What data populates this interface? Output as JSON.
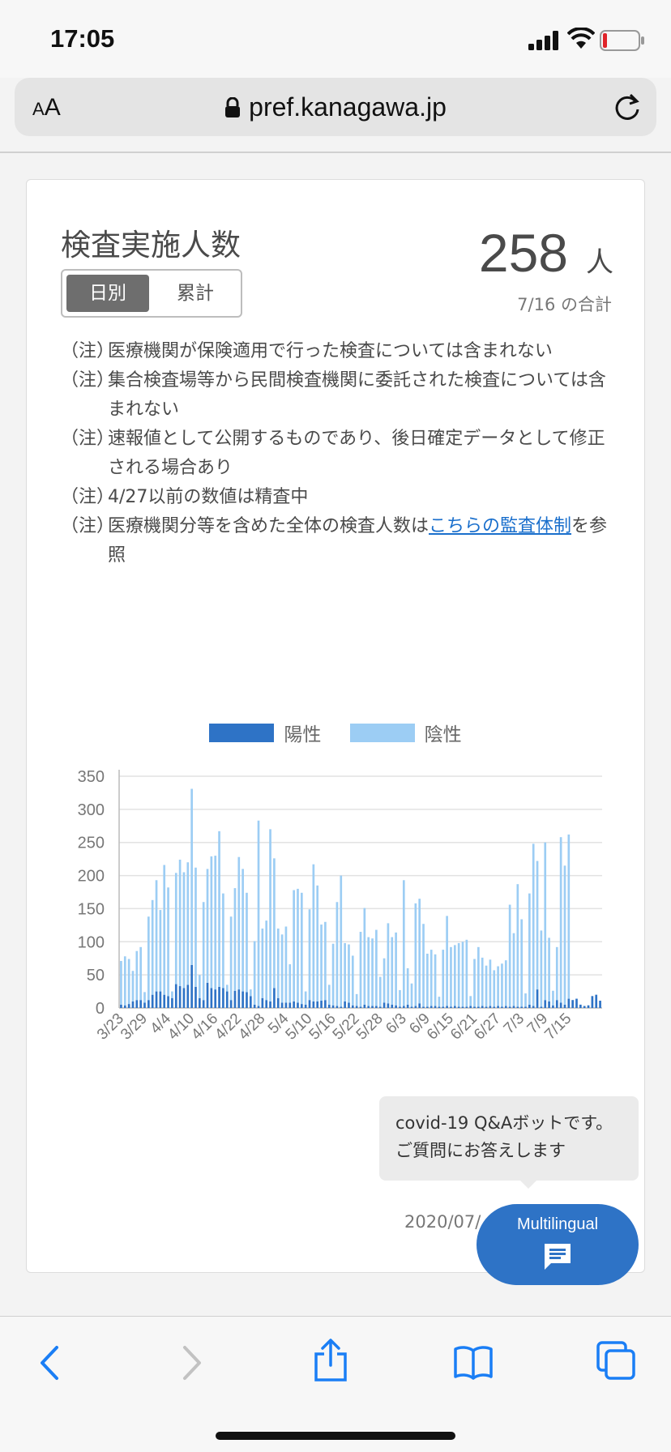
{
  "status_bar": {
    "time": "17:05"
  },
  "url_bar": {
    "text_size_label_small": "A",
    "text_size_label_large": "A",
    "domain": "pref.kanagawa.jp"
  },
  "card": {
    "title": "検査実施人数",
    "toggle": {
      "daily": "日別",
      "cumulative": "累計",
      "selected": "日別"
    },
    "total": {
      "value": "258",
      "unit": "人",
      "caption": "7/16 の合計"
    },
    "notes": [
      {
        "mark": "（注）",
        "text": "医療機関が保険適用で行った検査については含まれない"
      },
      {
        "mark": "（注）",
        "text": "集合検査場等から民間検査機関に委託された検査については含まれない"
      },
      {
        "mark": "（注）",
        "text": "速報値として公開するものであり、後日確定データとして修正される場合あり"
      },
      {
        "mark": "（注）",
        "text": "4/27以前の数値は精査中"
      },
      {
        "mark": "（注）",
        "text_before": "医療機関分等を含めた全体の検査人数は",
        "link": "こちらの監査体制",
        "text_after": "を参照"
      }
    ],
    "updated": "2020/07/"
  },
  "chart_data": {
    "type": "bar",
    "stacked": true,
    "x_tick_labels": [
      "3/23",
      "3/29",
      "4/4",
      "4/10",
      "4/16",
      "4/22",
      "4/28",
      "5/4",
      "5/10",
      "5/16",
      "5/22",
      "5/28",
      "6/3",
      "6/9",
      "6/15",
      "6/21",
      "6/27",
      "7/3",
      "7/9",
      "7/15"
    ],
    "first_day": "3/23",
    "last_day": "7/16",
    "ylim": [
      0,
      350
    ],
    "yticks": [
      0,
      50,
      100,
      150,
      200,
      250,
      300,
      350
    ],
    "grid": true,
    "legend_position": "top",
    "series": [
      {
        "name": "陽性",
        "color": "#2e73c6",
        "values": [
          5,
          4,
          6,
          10,
          12,
          12,
          8,
          12,
          20,
          25,
          25,
          20,
          18,
          15,
          36,
          33,
          30,
          35,
          65,
          32,
          15,
          12,
          38,
          30,
          28,
          32,
          30,
          25,
          12,
          26,
          28,
          25,
          24,
          18,
          5,
          3,
          15,
          12,
          10,
          30,
          15,
          8,
          8,
          8,
          10,
          8,
          6,
          5,
          12,
          10,
          10,
          11,
          12,
          5,
          4,
          3,
          2,
          10,
          8,
          4,
          3,
          2,
          5,
          3,
          3,
          3,
          2,
          8,
          7,
          5,
          4,
          2,
          3,
          5,
          2,
          3,
          7,
          2,
          2,
          3,
          3,
          2,
          2,
          3,
          2,
          3,
          2,
          2,
          2,
          3,
          2,
          2,
          3,
          2,
          3,
          2,
          3,
          2,
          3,
          2,
          3,
          2,
          2,
          2,
          5,
          3,
          28,
          2,
          12,
          10,
          4,
          12,
          8,
          5,
          14,
          12,
          14,
          5,
          3,
          4,
          18,
          20,
          11
        ]
      },
      {
        "name": "陰性",
        "color": "#9ccdf4",
        "values": [
          66,
          74,
          68,
          46,
          74,
          80,
          16,
          126,
          143,
          168,
          123,
          196,
          164,
          10,
          168,
          191,
          175,
          185,
          266,
          180,
          35,
          148,
          172,
          199,
          202,
          235,
          143,
          10,
          126,
          155,
          200,
          185,
          150,
          10,
          96,
          280,
          105,
          120,
          260,
          196,
          105,
          103,
          115,
          58,
          168,
          172,
          168,
          20,
          137,
          207,
          175,
          115,
          118,
          30,
          93,
          157,
          198,
          88,
          88,
          75,
          18,
          113,
          146,
          104,
          102,
          115,
          45,
          67,
          121,
          102,
          110,
          25,
          190,
          55,
          35,
          155,
          158,
          125,
          80,
          85,
          78,
          15,
          86,
          136,
          90,
          92,
          96,
          98,
          101,
          15,
          72,
          90,
          73,
          62,
          70,
          55,
          60,
          65,
          69,
          154,
          110,
          185,
          132,
          20,
          168,
          245,
          194,
          115,
          238,
          96,
          22,
          80,
          250,
          210,
          248
        ]
      }
    ],
    "legend": [
      "陽性",
      "陰性"
    ]
  },
  "chat": {
    "bubble_line1": "covid-19 Q&Aボットです。",
    "bubble_line2": "ご質問にお答えします",
    "button_label": "Multilingual"
  },
  "colors": {
    "positive": "#2e73c6",
    "negative": "#9ccdf4",
    "link": "#1a6fcc",
    "accent": "#1a7ef5"
  },
  "toolbar": {
    "icons": [
      "back-icon",
      "forward-icon",
      "share-icon",
      "bookmarks-icon",
      "tabs-icon"
    ]
  }
}
